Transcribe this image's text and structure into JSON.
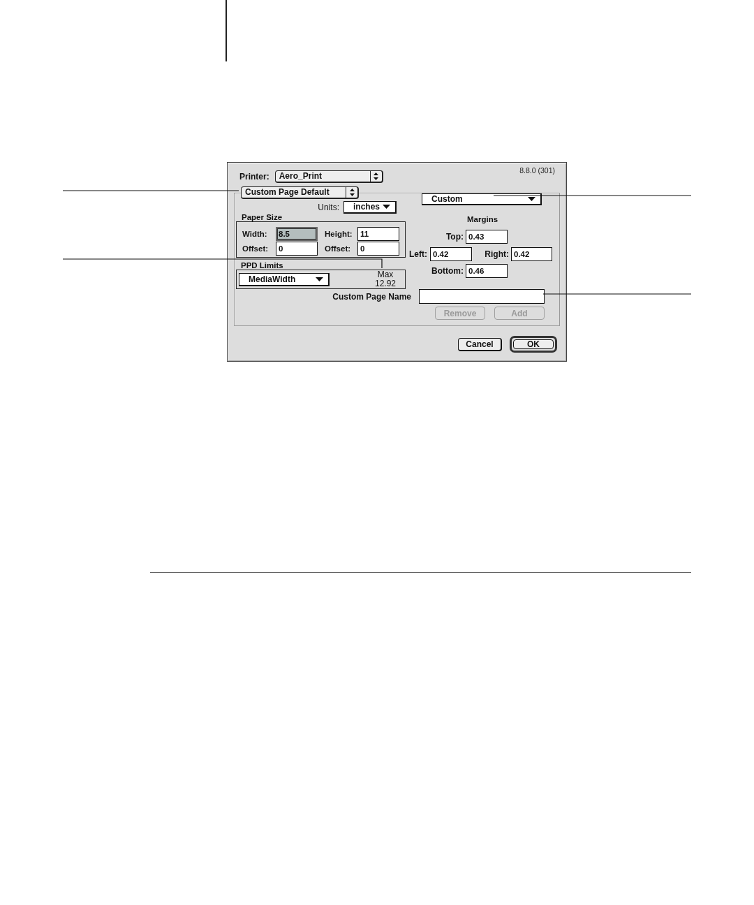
{
  "dialog": {
    "printer": {
      "label": "Printer:",
      "value": "Aero_Print"
    },
    "version": "8.8.0 (301)",
    "page_setting": "Custom Page Default",
    "units": {
      "label": "Units:",
      "value": "inches"
    },
    "paper_size": {
      "title": "Paper Size",
      "fields": [
        {
          "label": "Width:",
          "value": "8.5",
          "selected": true
        },
        {
          "label": "Height:",
          "value": "11",
          "selected": false
        },
        {
          "label": "Offset:",
          "value": "0",
          "selected": false
        },
        {
          "label": "Offset:",
          "value": "0",
          "selected": false
        }
      ]
    },
    "ppd_limits": {
      "title": "PPD Limits",
      "parameter": "MediaWidth",
      "max_label": "Max",
      "max_value": "12.92"
    },
    "page_size": "Custom",
    "margins": {
      "title": "Margins",
      "fields": [
        {
          "label": "Top:",
          "value": "0.43"
        },
        {
          "label": "Left:",
          "value": "0.42"
        },
        {
          "label": "Right:",
          "value": "0.42"
        },
        {
          "label": "Bottom:",
          "value": "0.46"
        }
      ]
    },
    "custom_page_name": {
      "label": "Custom Page Name"
    },
    "name_buttons": [
      {
        "label": "Remove",
        "disabled": true,
        "default": false
      },
      {
        "label": "Add",
        "disabled": true,
        "default": false
      }
    ],
    "dialog_buttons": [
      {
        "label": "Cancel",
        "disabled": false,
        "default": false
      },
      {
        "label": "OK",
        "disabled": false,
        "default": true
      }
    ]
  }
}
